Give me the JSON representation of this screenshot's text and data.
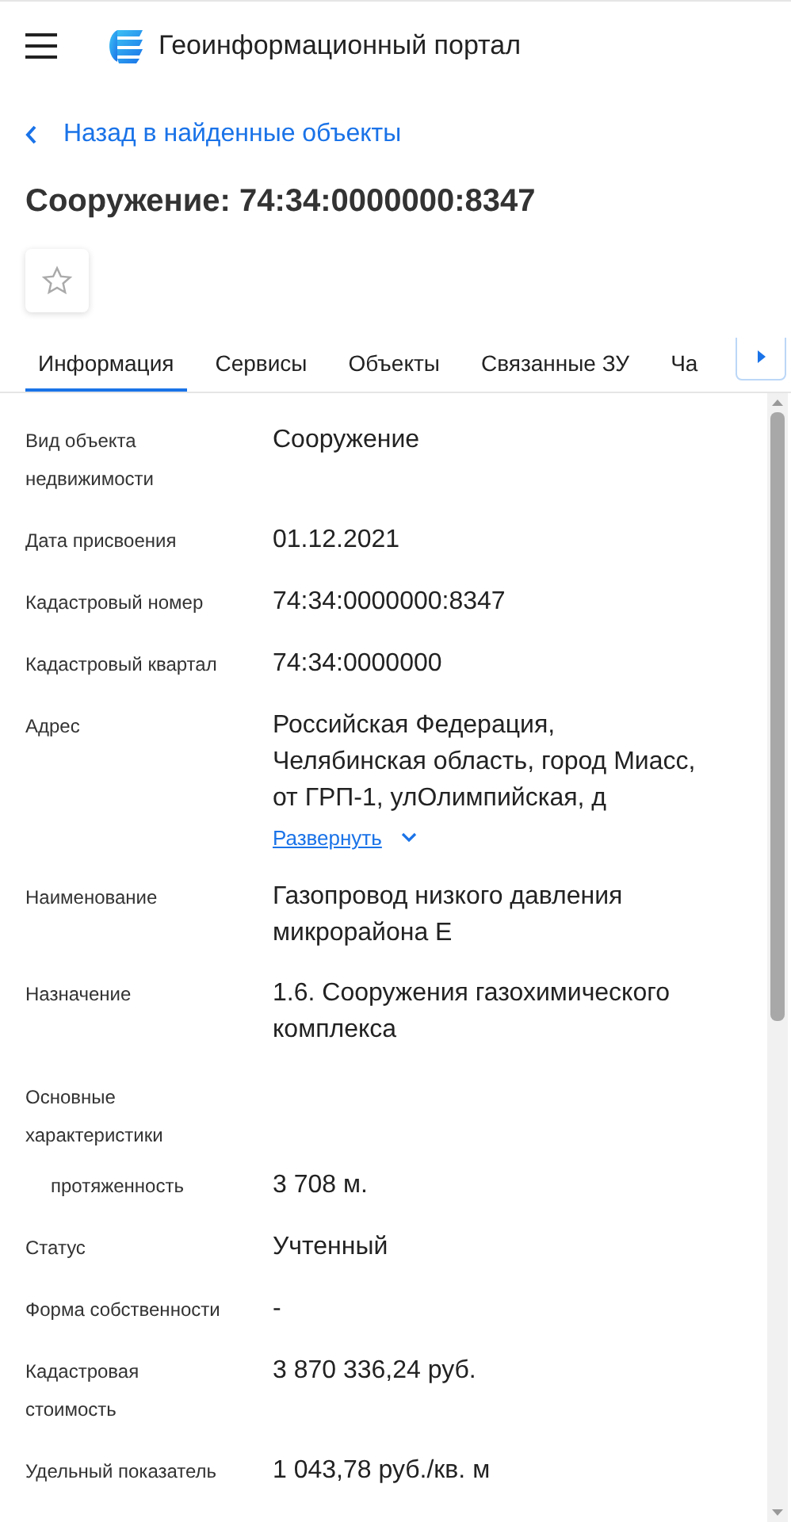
{
  "header": {
    "title": "Геоинформационный портал"
  },
  "back_link": "Назад в найденные объекты",
  "title": "Сооружение: 74:34:0000000:8347",
  "favorite": {
    "checked": false
  },
  "tabs": [
    {
      "label": "Информация",
      "selected": true
    },
    {
      "label": "Сервисы",
      "selected": false
    },
    {
      "label": "Объекты",
      "selected": false
    },
    {
      "label": "Связанные ЗУ",
      "selected": false
    },
    {
      "label": "Ча",
      "selected": false
    }
  ],
  "fields": [
    {
      "kind": "field",
      "label": "Вид объекта недвижимости",
      "value": "Сооружение"
    },
    {
      "kind": "field",
      "label": "Дата присвоения",
      "value": "01.12.2021"
    },
    {
      "kind": "field",
      "label": "Кадастровый номер",
      "value": "74:34:0000000:8347"
    },
    {
      "kind": "field",
      "label": "Кадастровый квартал",
      "value": "74:34:0000000"
    },
    {
      "kind": "field",
      "label": "Адрес",
      "value": "Российская Федерация, Челябинская область, город Миасс, от ГРП-1, улОлимпийская, д",
      "expand_link": "Развернуть"
    },
    {
      "kind": "field",
      "label": "Наименование",
      "value": "Газопровод низкого давления микрорайона Е"
    },
    {
      "kind": "field",
      "label": "Назначение",
      "value": "1.6. Сооружения газохимического комплекса"
    },
    {
      "kind": "group",
      "label": "Основные характеристики"
    },
    {
      "kind": "subfield",
      "label": "протяженность",
      "value": "3 708 м."
    },
    {
      "kind": "field",
      "label": "Статус",
      "value": "Учтенный"
    },
    {
      "kind": "field",
      "label": "Форма собственности",
      "value": "-"
    },
    {
      "kind": "field",
      "label": "Кадастровая стоимость",
      "value": "3 870 336,24 руб."
    },
    {
      "kind": "field",
      "label": "Удельный показатель",
      "value": "1 043,78 руб./кв. м"
    }
  ]
}
